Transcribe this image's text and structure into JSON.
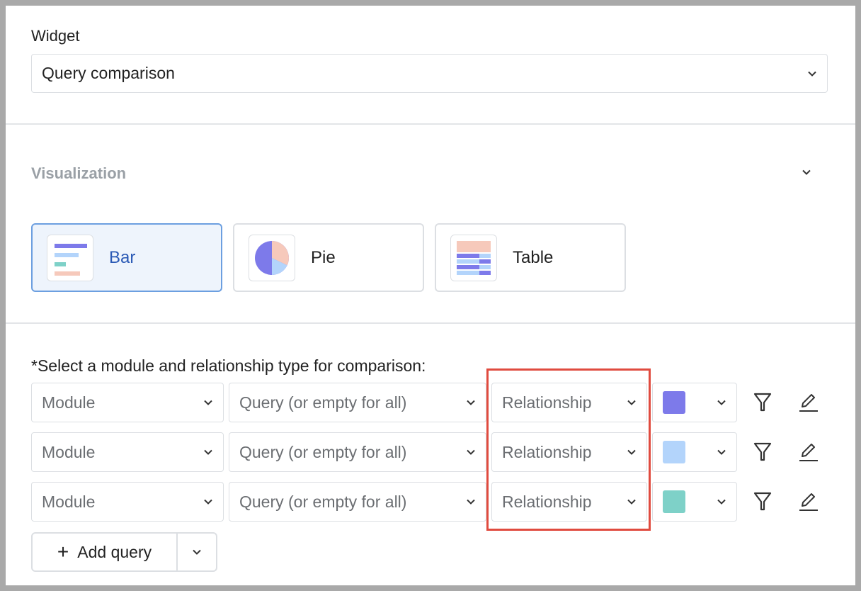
{
  "widget": {
    "label": "Widget",
    "value": "Query comparison"
  },
  "visualization": {
    "title": "Visualization",
    "options": [
      {
        "label": "Bar",
        "selected": true
      },
      {
        "label": "Pie",
        "selected": false
      },
      {
        "label": "Table",
        "selected": false
      }
    ]
  },
  "comparison": {
    "label": "*Select a module and relationship type for comparison:",
    "rows": [
      {
        "module": "Module",
        "query": "Query (or empty for all)",
        "relationship": "Relationship",
        "color": "#7d7aea"
      },
      {
        "module": "Module",
        "query": "Query (or empty for all)",
        "relationship": "Relationship",
        "color": "#b3d4fb"
      },
      {
        "module": "Module",
        "query": "Query (or empty for all)",
        "relationship": "Relationship",
        "color": "#7ed1c8"
      }
    ],
    "add_query_label": "Add query"
  },
  "colors": {
    "accent": "#2a59b5",
    "highlight": "#e04b3f",
    "selected_bg": "#eef4fc"
  }
}
